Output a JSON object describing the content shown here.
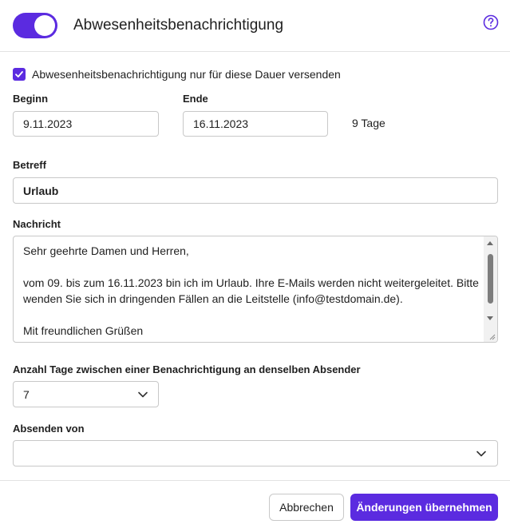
{
  "header": {
    "title": "Abwesenheitsbenachrichtigung",
    "toggle_on": true,
    "help_icon": "question-circle-icon"
  },
  "colors": {
    "accent": "#5b2be0",
    "border": "#c8c8c8",
    "text": "#1f1f1f"
  },
  "duration_checkbox": {
    "checked": true,
    "label": "Abwesenheitsbenachrichtigung nur für diese Dauer versenden"
  },
  "start": {
    "label": "Beginn",
    "value": "9.11.2023"
  },
  "end": {
    "label": "Ende",
    "value": "16.11.2023"
  },
  "duration_text": "9 Tage",
  "subject": {
    "label": "Betreff",
    "value": "Urlaub"
  },
  "message": {
    "label": "Nachricht",
    "lines": [
      "Sehr geehrte Damen und Herren,",
      "",
      "vom 09. bis zum 16.11.2023 bin ich im Urlaub. Ihre E-Mails werden nicht weitergeleitet. Bitte wenden Sie sich in dringenden Fällen an die Leitstelle (info@testdomain.de).",
      "",
      "Mit freundlichen Grüßen"
    ]
  },
  "days_between": {
    "label": "Anzahl Tage zwischen einer Benachrichtigung an denselben Absender",
    "value": "7"
  },
  "send_from": {
    "label": "Absenden von",
    "value": ""
  },
  "footer": {
    "cancel_label": "Abbrechen",
    "apply_label": "Änderungen übernehmen"
  }
}
